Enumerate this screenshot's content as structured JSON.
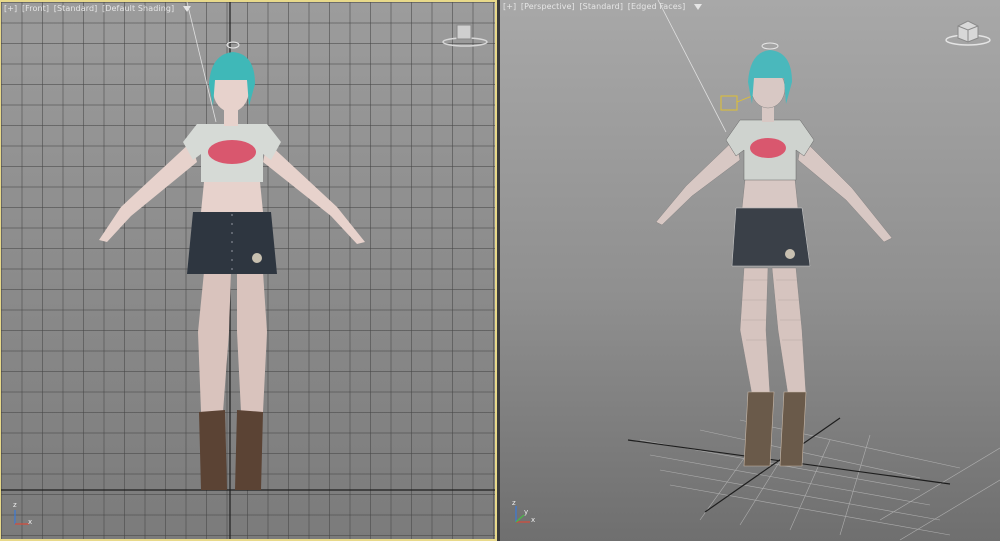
{
  "viewports": {
    "left": {
      "label": {
        "plus": "[+]",
        "view": "[Front]",
        "quality": "[Standard]",
        "shading": "[Default Shading]"
      },
      "axis": {
        "x": "x",
        "z": "z"
      },
      "active": true
    },
    "right": {
      "label": {
        "plus": "[+]",
        "view": "[Perspective]",
        "quality": "[Standard]",
        "shading": "[Edged Faces]"
      },
      "axis": {
        "x": "x",
        "y": "y",
        "z": "z"
      },
      "active": false
    }
  },
  "icons": {
    "filter": "funnel-icon",
    "viewcube": "viewcube-icon",
    "axis": "axis-tripod-icon"
  },
  "colors": {
    "active_border": "#e8d98a",
    "hair": "#3fb8b8",
    "skin": "#e7d2cc",
    "skirt": "#2e3640",
    "boots": "#5b4334"
  }
}
